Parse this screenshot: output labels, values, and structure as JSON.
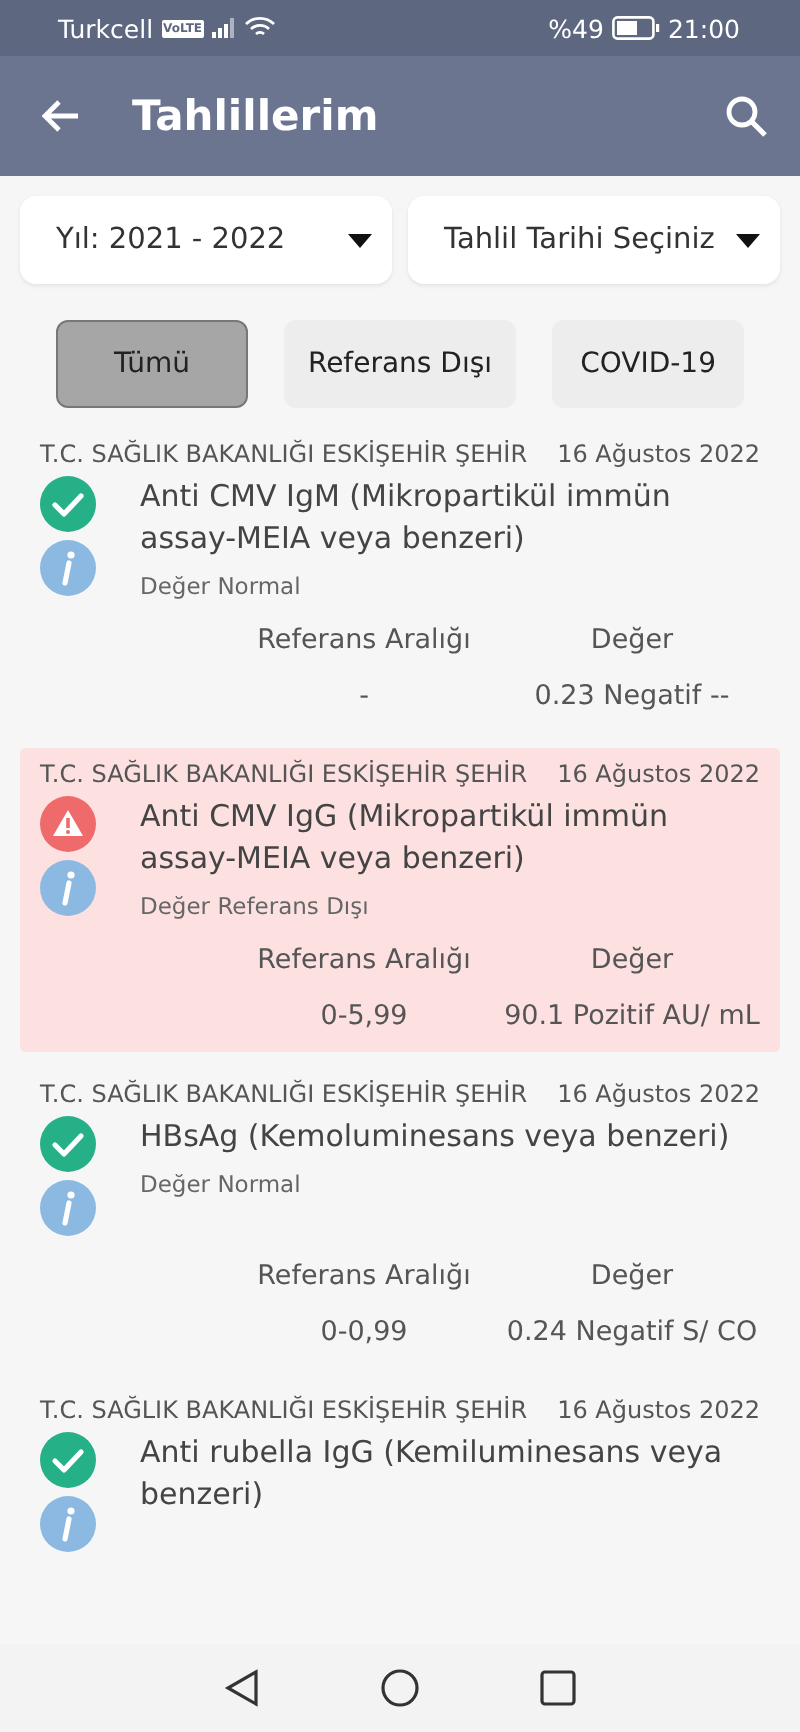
{
  "status_bar": {
    "carrier": "Turkcell",
    "volte": "VoLTE",
    "battery_text": "%49",
    "time": "21:00"
  },
  "app_bar": {
    "title": "Tahlillerim"
  },
  "filters": [
    {
      "label": "Yıl: 2021 - 2022"
    },
    {
      "label": "Tahlil Tarihi Seçiniz"
    }
  ],
  "chips": [
    {
      "label": "Tümü",
      "selected": true
    },
    {
      "label": "Referans Dışı",
      "selected": false
    },
    {
      "label": "COVID-19",
      "selected": false
    }
  ],
  "results": [
    {
      "source": "T.C. SAĞLIK BAKANLIĞI ESKİŞEHİR ŞEHİR",
      "date": "16 Ağustos 2022",
      "kind": "normal",
      "title": "Anti CMV IgM (Mikropartikül immün assay-MEIA veya benzeri)",
      "status_text": "Değer Normal",
      "table": {
        "headers": [
          "Referans Aralığı",
          "Değer"
        ],
        "values": [
          "-",
          "0.23 Negatif --"
        ]
      }
    },
    {
      "source": "T.C. SAĞLIK BAKANLIĞI ESKİŞEHİR ŞEHİR",
      "date": "16 Ağustos 2022",
      "kind": "out_of_range",
      "title": "Anti CMV IgG (Mikropartikül immün assay-MEIA veya benzeri)",
      "status_text": "Değer Referans Dışı",
      "table": {
        "headers": [
          "Referans Aralığı",
          "Değer"
        ],
        "values": [
          "0-5,99",
          "90.1 Pozitif AU/ mL"
        ]
      }
    },
    {
      "source": "T.C. SAĞLIK BAKANLIĞI ESKİŞEHİR ŞEHİR",
      "date": "16 Ağustos 2022",
      "kind": "normal",
      "title": "HBsAg (Kemoluminesans veya benzeri)",
      "status_text": "Değer Normal",
      "table": {
        "headers": [
          "Referans Aralığı",
          "Değer"
        ],
        "values": [
          "0-0,99",
          "0.24 Negatif S/ CO"
        ]
      }
    },
    {
      "source": "T.C. SAĞLIK BAKANLIĞI ESKİŞEHİR ŞEHİR",
      "date": "16 Ağustos 2022",
      "kind": "normal",
      "title": "Anti rubella IgG (Kemiluminesans veya benzeri)"
    }
  ]
}
